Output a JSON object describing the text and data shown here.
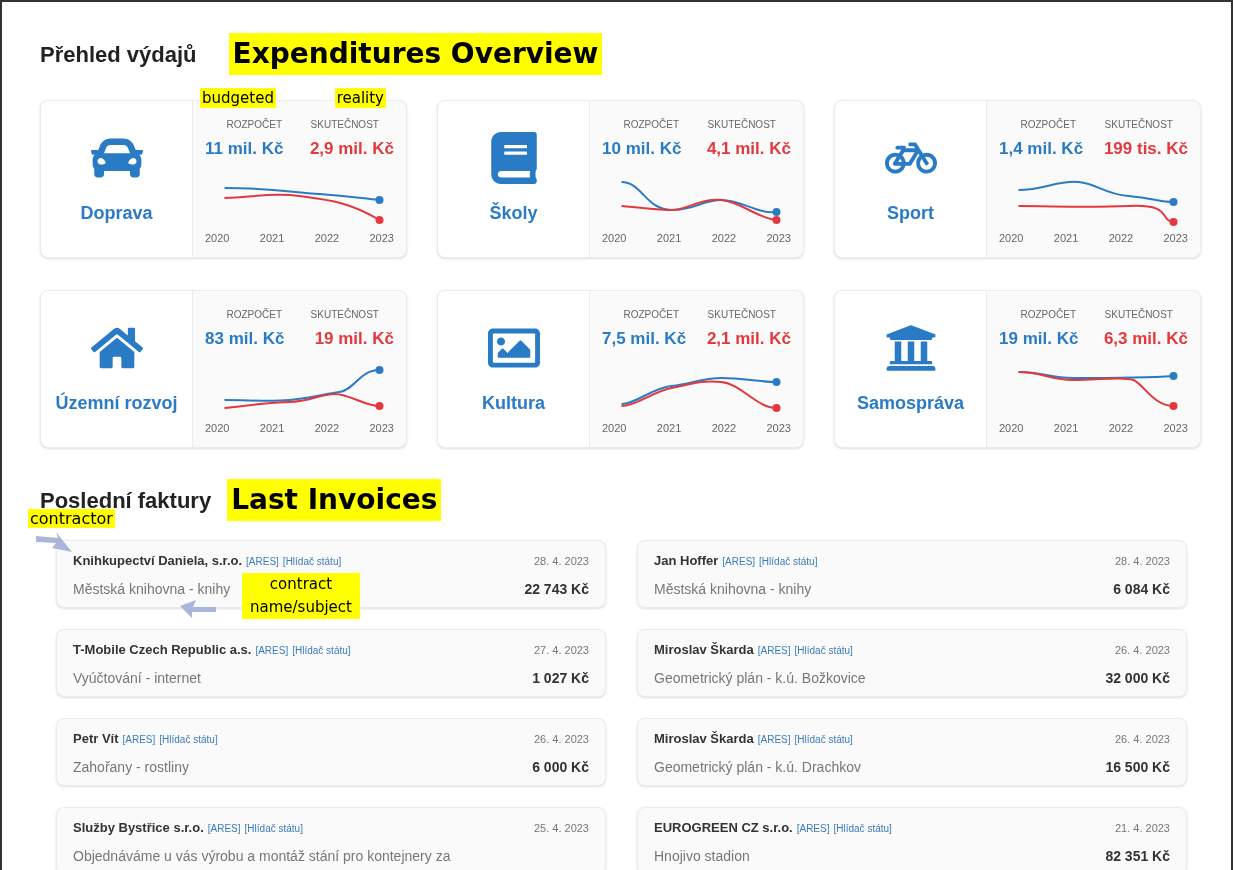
{
  "heading": "Přehled výdajů",
  "heading_note": "Expenditures Overview",
  "column_notes": [
    "budgeted",
    "reality"
  ],
  "categories": [
    {
      "name": "Doprava",
      "budget_label": "ROZPOČET",
      "budget": "11 mil. Kč",
      "actual_label": "SKUTEČNOST",
      "actual": "2,9 mil. Kč",
      "years": [
        "2020",
        "2021",
        "2022",
        "2023"
      ]
    },
    {
      "name": "Školy",
      "budget_label": "ROZPOČET",
      "budget": "10 mil. Kč",
      "actual_label": "SKUTEČNOST",
      "actual": "4,1 mil. Kč",
      "years": [
        "2020",
        "2021",
        "2022",
        "2023"
      ]
    },
    {
      "name": "Sport",
      "budget_label": "ROZPOČET",
      "budget": "1,4 mil. Kč",
      "actual_label": "SKUTEČNOST",
      "actual": "199 tis. Kč",
      "years": [
        "2020",
        "2021",
        "2022",
        "2023"
      ]
    },
    {
      "name": "Územní rozvoj",
      "budget_label": "ROZPOČET",
      "budget": "83 mil. Kč",
      "actual_label": "SKUTEČNOST",
      "actual": "19 mil. Kč",
      "years": [
        "2020",
        "2021",
        "2022",
        "2023"
      ]
    },
    {
      "name": "Kultura",
      "budget_label": "ROZPOČET",
      "budget": "7,5 mil. Kč",
      "actual_label": "SKUTEČNOST",
      "actual": "2,1 mil. Kč",
      "years": [
        "2020",
        "2021",
        "2022",
        "2023"
      ]
    },
    {
      "name": "Samospráva",
      "budget_label": "ROZPOČET",
      "budget": "19 mil. Kč",
      "actual_label": "SKUTEČNOST",
      "actual": "6,3 mil. Kč",
      "years": [
        "2020",
        "2021",
        "2022",
        "2023"
      ]
    }
  ],
  "invoices_heading": "Poslední faktury",
  "invoices_note": "Last Invoices",
  "contractor_note": "contractor",
  "subject_note": "contract name/subject",
  "invoices": [
    {
      "contractor": "Knihkupectví Daniela, s.r.o.",
      "links": [
        "[ARES]",
        "[Hlídač státu]"
      ],
      "date": "28. 4. 2023",
      "subject": "Městská knihovna - knihy",
      "amount": "22 743 Kč"
    },
    {
      "contractor": "Jan Hoffer",
      "links": [
        "[ARES]",
        "[Hlídač státu]"
      ],
      "date": "28. 4. 2023",
      "subject": "Městská knihovna - knihy",
      "amount": "6 084 Kč"
    },
    {
      "contractor": "T-Mobile Czech Republic a.s.",
      "links": [
        "[ARES]",
        "[Hlídač státu]"
      ],
      "date": "27. 4. 2023",
      "subject": "Vyúčtování - internet",
      "amount": "1 027 Kč"
    },
    {
      "contractor": "Miroslav Škarda",
      "links": [
        "[ARES]",
        "[Hlídač státu]"
      ],
      "date": "26. 4. 2023",
      "subject": "Geometrický plán - k.ú. Božkovice",
      "amount": "32 000 Kč"
    },
    {
      "contractor": "Petr Vít",
      "links": [
        "[ARES]",
        "[Hlídač státu]"
      ],
      "date": "26. 4. 2023",
      "subject": "Zahořany - rostliny",
      "amount": "6 000 Kč"
    },
    {
      "contractor": "Miroslav Škarda",
      "links": [
        "[ARES]",
        "[Hlídač státu]"
      ],
      "date": "26. 4. 2023",
      "subject": "Geometrický plán - k.ú. Drachkov",
      "amount": "16 500 Kč"
    },
    {
      "contractor": "Služby Bystřice s.r.o.",
      "links": [
        "[ARES]",
        "[Hlídač státu]"
      ],
      "date": "25. 4. 2023",
      "subject": "Objednáváme u vás výrobu a montáž stání pro kontejnery za"
    },
    {
      "contractor": "EUROGREEN CZ s.r.o.",
      "links": [
        "[ARES]",
        "[Hlídač státu]"
      ],
      "date": "21. 4. 2023",
      "subject": "Hnojivo stadion",
      "amount": "82 351 Kč"
    }
  ]
}
